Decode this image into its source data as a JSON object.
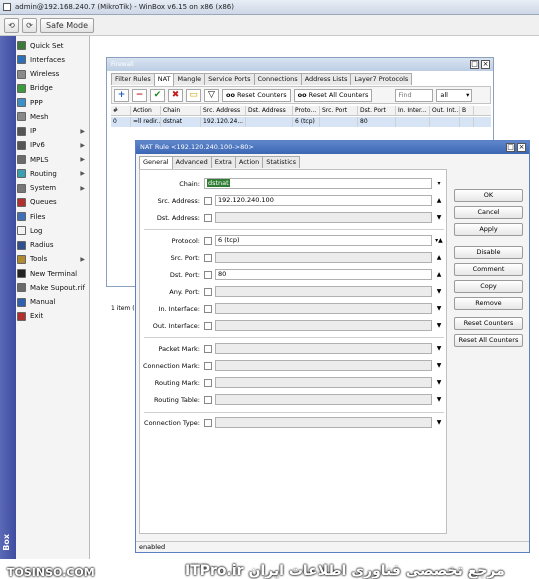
{
  "window": {
    "title": "admin@192.168.240.7 (MikroTik) - WinBox v6.15 on x86 (x86)"
  },
  "toolbar": {
    "undo": "⟲",
    "redo": "⟳",
    "safe_mode": "Safe Mode"
  },
  "sidebar": {
    "vertical_label": "Box",
    "items": [
      {
        "label": "Quick Set",
        "icon": "quick-set-icon",
        "color": "#3a7a3a",
        "arrow": ""
      },
      {
        "label": "Interfaces",
        "icon": "interfaces-icon",
        "color": "#2d6fb8",
        "arrow": ""
      },
      {
        "label": "Wireless",
        "icon": "wireless-icon",
        "color": "#8a8a8a",
        "arrow": ""
      },
      {
        "label": "Bridge",
        "icon": "bridge-icon",
        "color": "#3c9a3c",
        "arrow": ""
      },
      {
        "label": "PPP",
        "icon": "ppp-icon",
        "color": "#3c8fc9",
        "arrow": ""
      },
      {
        "label": "Mesh",
        "icon": "mesh-icon",
        "color": "#888888",
        "arrow": ""
      },
      {
        "label": "IP",
        "icon": "ip-icon",
        "color": "#555555",
        "arrow": "▶"
      },
      {
        "label": "IPv6",
        "icon": "ipv6-icon",
        "color": "#555555",
        "arrow": "▶"
      },
      {
        "label": "MPLS",
        "icon": "mpls-icon",
        "color": "#6b6b6b",
        "arrow": "▶"
      },
      {
        "label": "Routing",
        "icon": "routing-icon",
        "color": "#3aa0b0",
        "arrow": "▶"
      },
      {
        "label": "System",
        "icon": "system-icon",
        "color": "#777777",
        "arrow": "▶"
      },
      {
        "label": "Queues",
        "icon": "queues-icon",
        "color": "#b03030",
        "arrow": ""
      },
      {
        "label": "Files",
        "icon": "files-icon",
        "color": "#3f6fb8",
        "arrow": ""
      },
      {
        "label": "Log",
        "icon": "log-icon",
        "color": "#f2f2f2",
        "arrow": ""
      },
      {
        "label": "Radius",
        "icon": "radius-icon",
        "color": "#2f4f8f",
        "arrow": ""
      },
      {
        "label": "Tools",
        "icon": "tools-icon",
        "color": "#b08a30",
        "arrow": "▶"
      },
      {
        "label": "New Terminal",
        "icon": "terminal-icon",
        "color": "#222222",
        "arrow": ""
      },
      {
        "label": "Make Supout.rif",
        "icon": "supout-icon",
        "color": "#6b6b6b",
        "arrow": ""
      },
      {
        "label": "Manual",
        "icon": "manual-icon",
        "color": "#3060b0",
        "arrow": ""
      },
      {
        "label": "Exit",
        "icon": "exit-icon",
        "color": "#b03030",
        "arrow": ""
      }
    ]
  },
  "firewall": {
    "title": "Firewall",
    "tabs": [
      "Filter Rules",
      "NAT",
      "Mangle",
      "Service Ports",
      "Connections",
      "Address Lists",
      "Layer7 Protocols"
    ],
    "active_tab": "NAT",
    "reset_counters": "Reset Counters",
    "reset_all_counters": "Reset All Counters",
    "find_placeholder": "Find",
    "filter_value": "all",
    "columns": [
      "#",
      "Action",
      "Chain",
      "Src. Address",
      "Dst. Address",
      "Proto...",
      "Src. Port",
      "Dst. Port",
      "In. Inter...",
      "Out. Int...",
      "B"
    ],
    "rows": [
      [
        "0",
        "=ll redir...",
        "dstnat",
        "192.120.24...",
        "",
        "6 (tcp)",
        "",
        "80",
        "",
        "",
        ""
      ]
    ],
    "status": "1 item (1"
  },
  "nat_rule": {
    "title": "NAT Rule <192.120.240.100->80>",
    "tabs": [
      "General",
      "Advanced",
      "Extra",
      "Action",
      "Statistics"
    ],
    "active_tab": "General",
    "fields": {
      "chain": {
        "label": "Chain:",
        "value": "dstnat"
      },
      "src_address": {
        "label": "Src. Address:",
        "value": "192.120.240.100"
      },
      "dst_address": {
        "label": "Dst. Address:",
        "value": ""
      },
      "protocol": {
        "label": "Protocol:",
        "value": "6 (tcp)"
      },
      "src_port": {
        "label": "Src. Port:",
        "value": ""
      },
      "dst_port": {
        "label": "Dst. Port:",
        "value": "80"
      },
      "any_port": {
        "label": "Any. Port:",
        "value": ""
      },
      "in_interface": {
        "label": "In. Interface:",
        "value": ""
      },
      "out_interface": {
        "label": "Out. Interface:",
        "value": ""
      },
      "packet_mark": {
        "label": "Packet Mark:",
        "value": ""
      },
      "connection_mark": {
        "label": "Connection Mark:",
        "value": ""
      },
      "routing_mark": {
        "label": "Routing Mark:",
        "value": ""
      },
      "routing_table": {
        "label": "Routing Table:",
        "value": ""
      },
      "connection_type": {
        "label": "Connection Type:",
        "value": ""
      }
    },
    "buttons": [
      "OK",
      "Cancel",
      "Apply",
      "Disable",
      "Comment",
      "Copy",
      "Remove",
      "Reset Counters",
      "Reset All Counters"
    ],
    "status": "enabled"
  },
  "highlight_color": "#ffff00",
  "watermarks": {
    "left": "TOSINSO.COM",
    "right": "ITPro.ir مرجع تخصصی فناوری اطلاعات ایران"
  }
}
